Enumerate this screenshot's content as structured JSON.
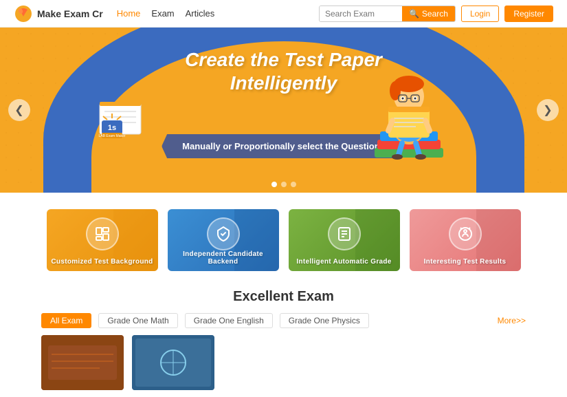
{
  "navbar": {
    "logo_text": "Make Exam Cr",
    "nav_items": [
      {
        "label": "Home",
        "active": true
      },
      {
        "label": "Exam",
        "active": false
      },
      {
        "label": "Articles",
        "active": false
      }
    ],
    "search_placeholder": "Search Exam",
    "search_btn_label": "Search",
    "login_label": "Login",
    "register_label": "Register"
  },
  "hero": {
    "title_line1": "Create the Test Paper",
    "title_line2": "Intelligently",
    "subtitle": "Manually or Proportionally select the Questions",
    "left_arrow": "❮",
    "right_arrow": "❯"
  },
  "features": [
    {
      "label": "Customized Test Background",
      "icon": "📋",
      "style": "card-yellow"
    },
    {
      "label": "Independent Candidate Backend",
      "icon": "📦",
      "style": "card-blue"
    },
    {
      "label": "Intelligent Automatic Grade",
      "icon": "📄",
      "style": "card-green"
    },
    {
      "label": "Interesting Test Results",
      "icon": "🧠",
      "style": "card-pink"
    }
  ],
  "excellent_exam": {
    "section_title": "Excellent Exam",
    "tabs": [
      {
        "label": "All Exam",
        "active": true
      },
      {
        "label": "Grade One Math",
        "active": false
      },
      {
        "label": "Grade One English",
        "active": false
      },
      {
        "label": "Grade One Physics",
        "active": false
      }
    ],
    "more_label": "More>>"
  }
}
